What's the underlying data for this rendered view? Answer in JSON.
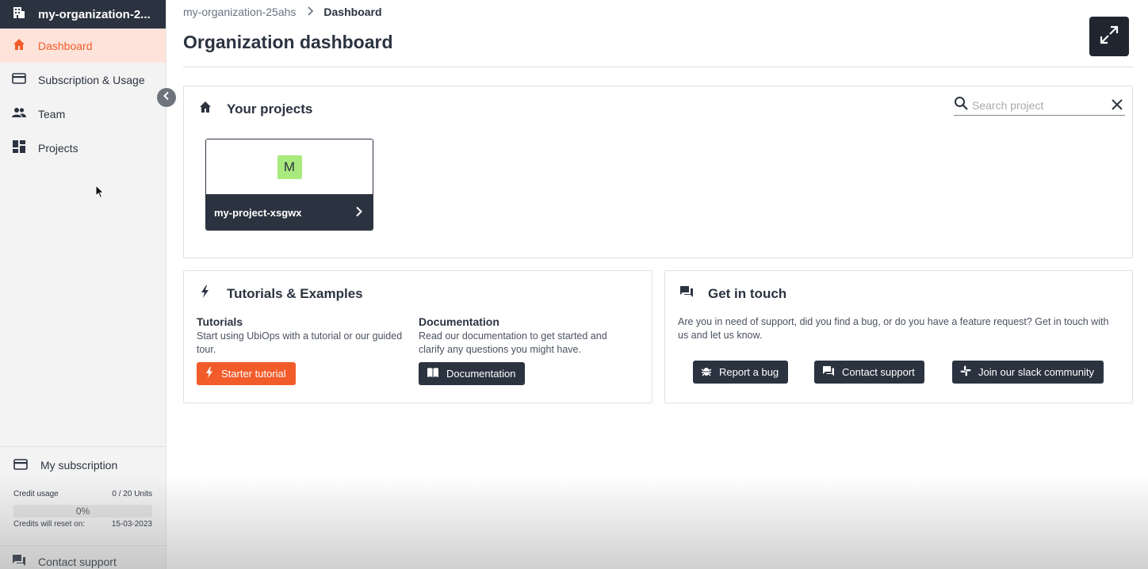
{
  "sidebar": {
    "org_name": "my-organization-2...",
    "items": [
      {
        "label": "Dashboard",
        "icon": "home-icon",
        "active": true
      },
      {
        "label": "Subscription & Usage",
        "icon": "credit-card-icon",
        "active": false
      },
      {
        "label": "Team",
        "icon": "people-icon",
        "active": false
      },
      {
        "label": "Projects",
        "icon": "dashboard-grid-icon",
        "active": false
      }
    ],
    "subscription": {
      "title": "My subscription",
      "credit_label": "Credit usage",
      "credit_value": "0 / 20 Units",
      "progress_percent": 0,
      "progress_text": "0%",
      "reset_label": "Credits will reset on:",
      "reset_date": "15-03-2023"
    },
    "support_label": "Contact support"
  },
  "breadcrumb": {
    "org": "my-organization-25ahs",
    "current": "Dashboard"
  },
  "page_title": "Organization dashboard",
  "projects": {
    "title": "Your projects",
    "search_placeholder": "Search project",
    "items": [
      {
        "initial": "M",
        "name": "my-project-xsgwx"
      }
    ]
  },
  "tutorials": {
    "title": "Tutorials & Examples",
    "tutorials_title": "Tutorials",
    "tutorials_desc": "Start using UbiOps with a tutorial or our guided tour.",
    "tutorial_button": "Starter tutorial",
    "docs_title": "Documentation",
    "docs_desc": "Read our documentation to get started and clarify any questions you might have.",
    "docs_button": "Documentation"
  },
  "touch": {
    "title": "Get in touch",
    "desc": "Are you in need of support, did you find a bug, or do you have a feature request? Get in touch with us and let us know.",
    "bug_button": "Report a bug",
    "support_button": "Contact support",
    "slack_button": "Join our slack community"
  },
  "colors": {
    "accent": "#f25c2a",
    "dark": "#2b3340",
    "active_bg": "#fde3da",
    "avatar": "#a9ea7e"
  }
}
